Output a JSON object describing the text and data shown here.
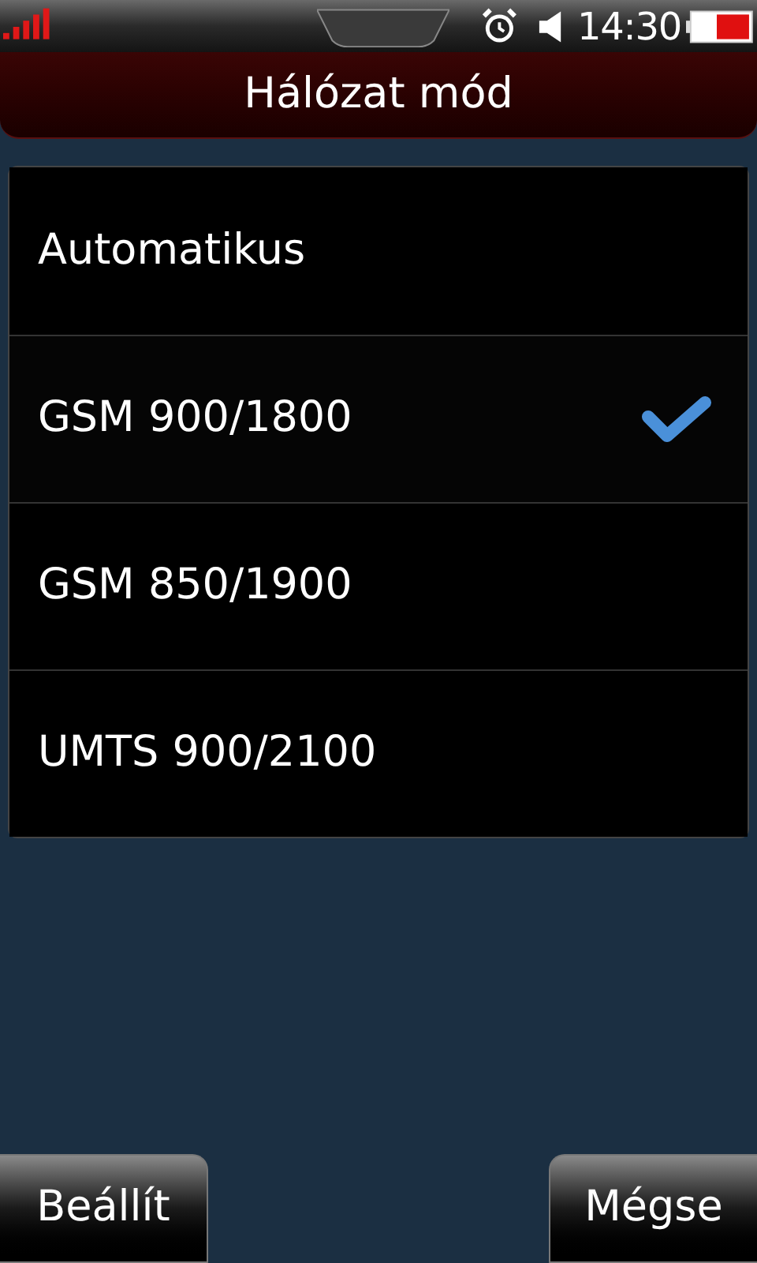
{
  "status_bar": {
    "time": "14:30"
  },
  "title": "Hálózat mód",
  "options": [
    {
      "label": "Automatikus",
      "selected": false
    },
    {
      "label": "GSM 900/1800",
      "selected": true
    },
    {
      "label": "GSM 850/1900",
      "selected": false
    },
    {
      "label": "UMTS 900/2100",
      "selected": false
    }
  ],
  "buttons": [
    "Beállít",
    "Mégse"
  ]
}
